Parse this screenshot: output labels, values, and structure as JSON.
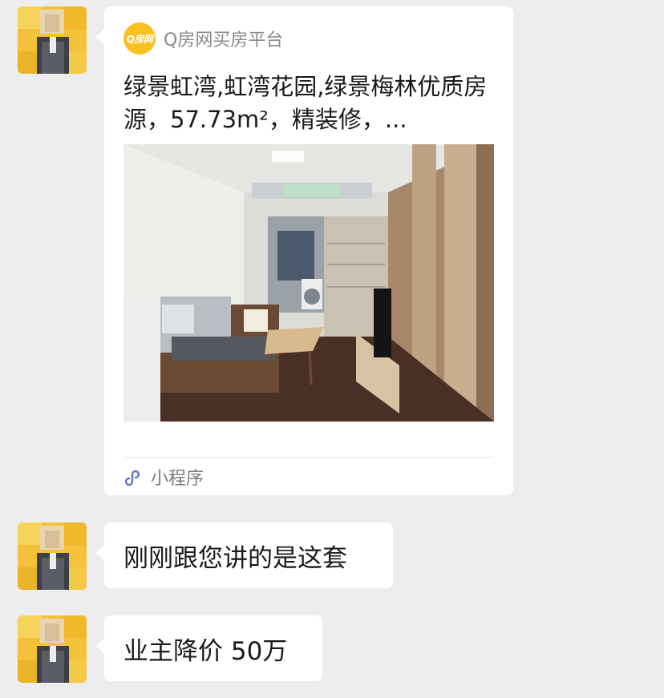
{
  "messages": [
    {
      "type": "miniprogram-card",
      "source": "Q房网买房平台",
      "logo_text": "Q房网",
      "title": "绿景虹湾,虹湾花园,绿景梅林优质房源，57.73m²，精装修，...",
      "footer_label": "小程序"
    },
    {
      "type": "text",
      "text": "刚刚跟您讲的是这套"
    },
    {
      "type": "text",
      "text": "业主降价 50万"
    }
  ],
  "colors": {
    "background": "#ededed",
    "bubble": "#ffffff",
    "brand_yellow": "#f9c022",
    "miniprogram_icon": "#6476c8"
  },
  "icons": {
    "logo": "qfang-logo-icon",
    "footer": "miniprogram-icon"
  }
}
